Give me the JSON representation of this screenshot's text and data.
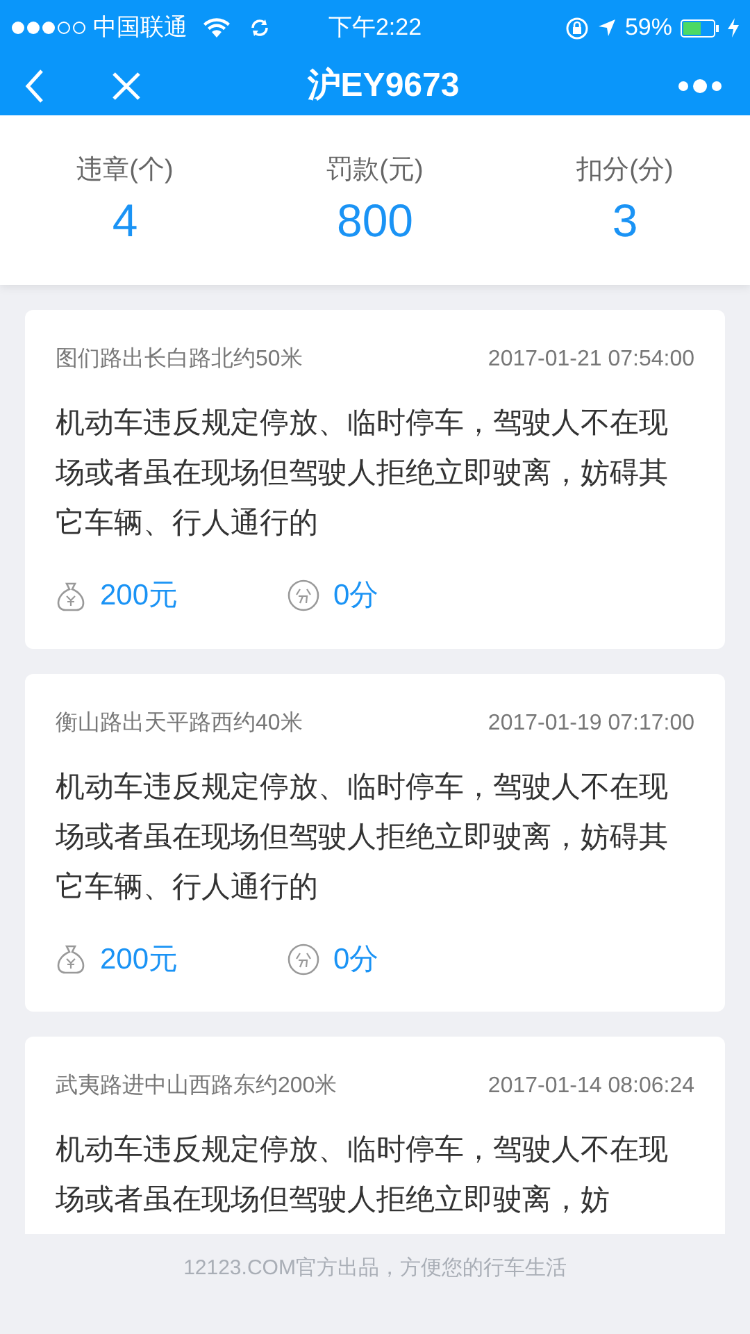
{
  "status_bar": {
    "carrier": "中国联通",
    "time": "下午2:22",
    "battery": "59%"
  },
  "nav": {
    "title": "沪EY9673"
  },
  "summary": [
    {
      "label": "违章(个)",
      "value": "4"
    },
    {
      "label": "罚款(元)",
      "value": "800"
    },
    {
      "label": "扣分(分)",
      "value": "3"
    }
  ],
  "violations": [
    {
      "location": "图们路出长白路北约50米",
      "time": "2017-01-21 07:54:00",
      "description": "机动车违反规定停放、临时停车，驾驶人不在现场或者虽在现场但驾驶人拒绝立即驶离，妨碍其它车辆、行人通行的",
      "fine": "200元",
      "points": "0分"
    },
    {
      "location": "衡山路出天平路西约40米",
      "time": "2017-01-19 07:17:00",
      "description": "机动车违反规定停放、临时停车，驾驶人不在现场或者虽在现场但驾驶人拒绝立即驶离，妨碍其它车辆、行人通行的",
      "fine": "200元",
      "points": "0分"
    },
    {
      "location": "武夷路进中山西路东约200米",
      "time": "2017-01-14 08:06:24",
      "description": "机动车违反规定停放、临时停车，驾驶人不在现场或者虽在现场但驾驶人拒绝立即驶离，妨"
    }
  ],
  "footer": "12123.COM官方出品，方便您的行车生活"
}
